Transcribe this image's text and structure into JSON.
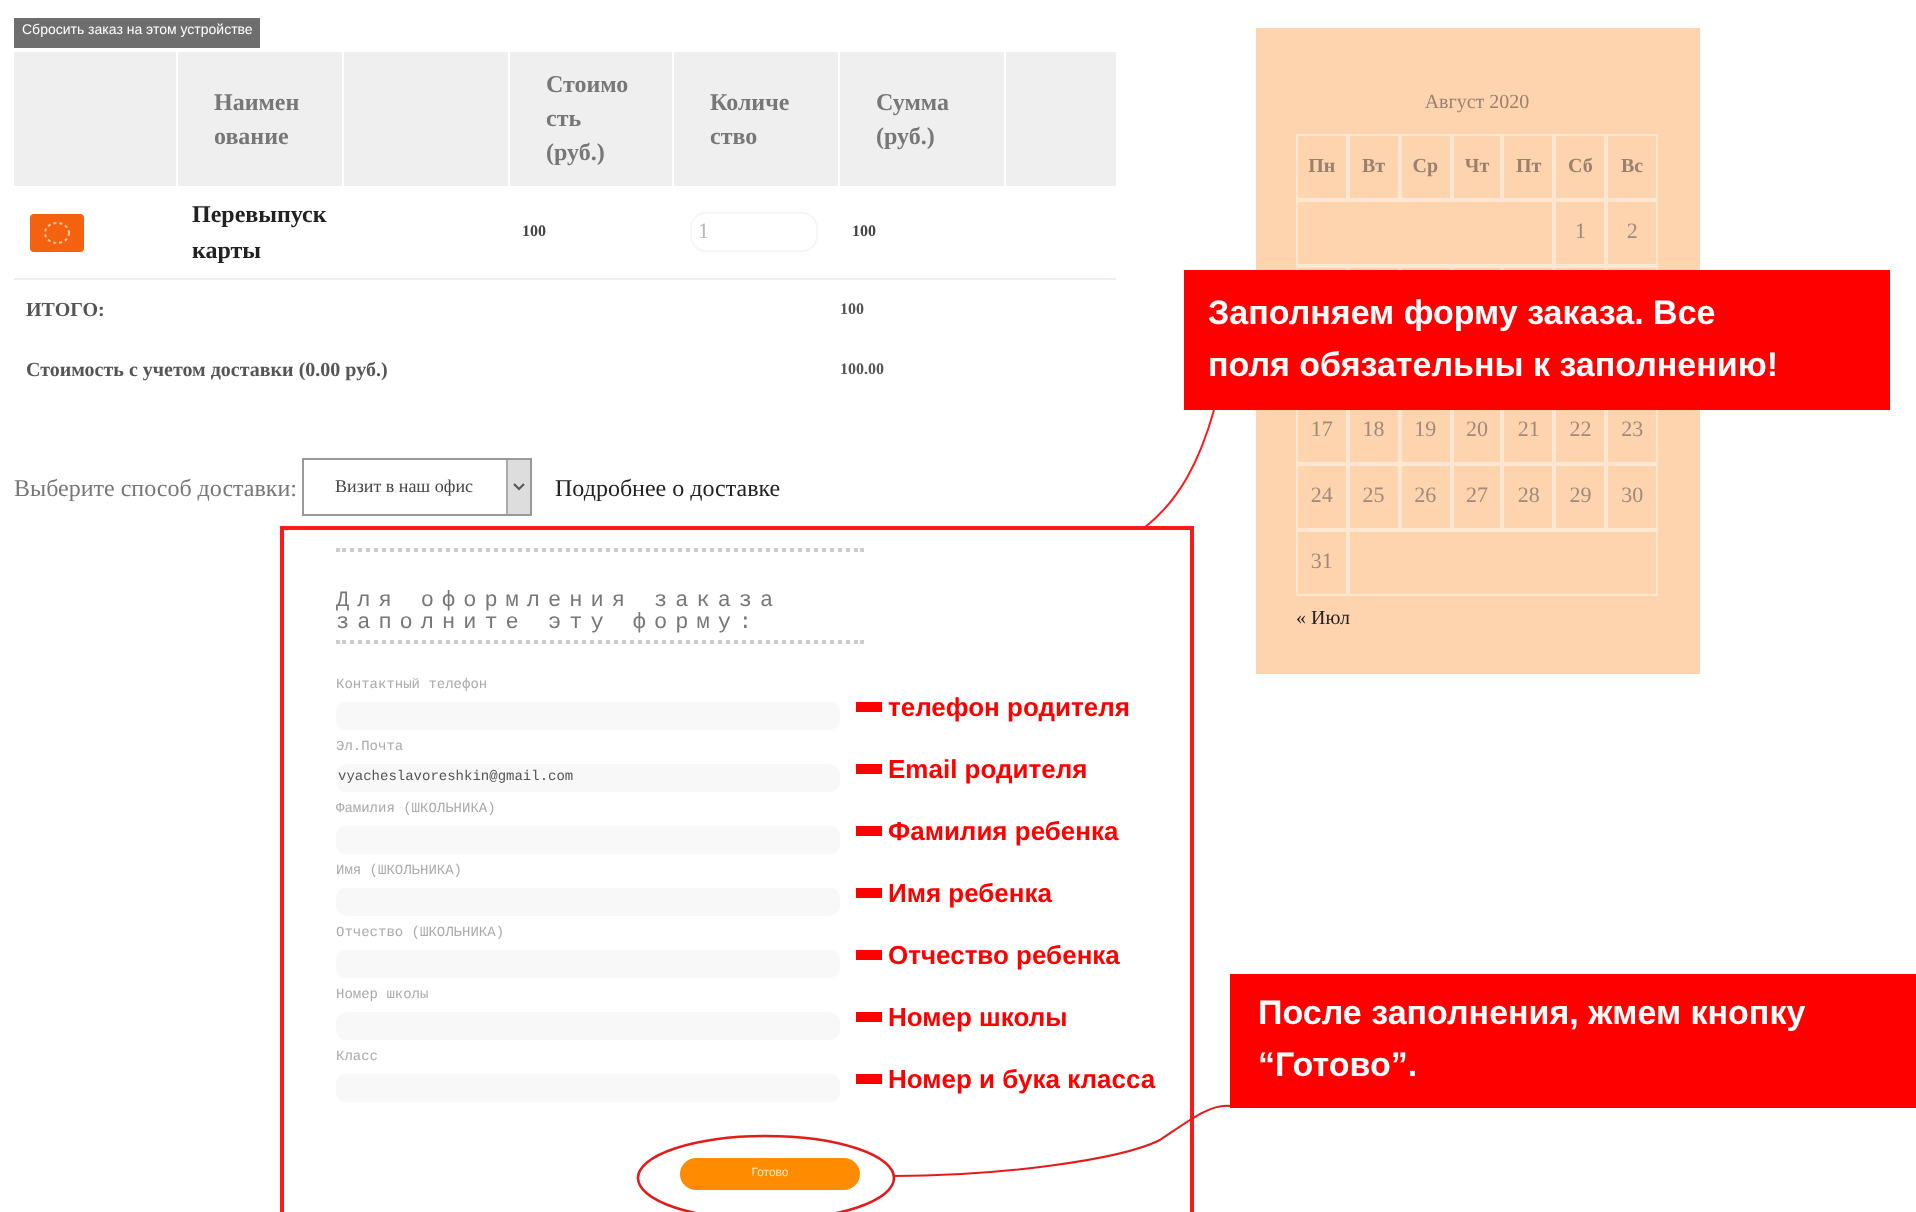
{
  "reset_button": "Сбросить заказ на этом устройстве",
  "cart_table": {
    "columns": [
      "Наимен\nование",
      "Стоимо\nсть\n(руб.)",
      "Количе\nство",
      "Сумма\n(руб.)"
    ],
    "rows": [
      {
        "kind": "item",
        "name": "Перевыпуск\nкарты",
        "price": "100",
        "quantity": "1",
        "sum": "100"
      }
    ],
    "totals": [
      {
        "label": "ИТОГО:",
        "value": "100"
      },
      {
        "label": "Стоимость с учетом доставки (0.00 руб.)",
        "value": "100.00"
      }
    ]
  },
  "delivery": {
    "label": "Выберите способ доставки:",
    "value": "Визит в наш офис",
    "link": "Подробнее о доставке"
  },
  "form": {
    "heading": "Для оформления заказа\nзаполните эту форму:",
    "fields": [
      {
        "label": "Контактный телефон",
        "annotation": "телефон родителя"
      },
      {
        "label": "Эл.Почта",
        "value": "vyacheslavoreshkin@gmail.com",
        "annotation": "Email родителя"
      },
      {
        "label": "Фамилия (ШКОЛЬНИКА)",
        "annotation": "Фамилия ребенка"
      },
      {
        "label": "Имя (ШКОЛЬНИКА)",
        "annotation": "Имя ребенка"
      },
      {
        "label": "Отчество (ШКОЛЬНИКА)",
        "annotation": "Отчество ребенка"
      },
      {
        "label": "Номер школы",
        "annotation": "Номер школы"
      },
      {
        "label": "Класс",
        "annotation": "Номер и бука класса"
      }
    ],
    "submit": "Готово"
  },
  "calendar": {
    "title": "Август 2020",
    "weekdays": [
      "Пн",
      "Вт",
      "Ср",
      "Чт",
      "Пт",
      "Сб",
      "Вс"
    ],
    "weeks_top": [
      {
        "kind": "start",
        "days": [
          "1",
          "2"
        ]
      }
    ],
    "weeks_bottom": [
      {
        "kind": "full",
        "days": [
          "17",
          "18",
          "19",
          "20",
          "21",
          "22",
          "23"
        ]
      },
      {
        "kind": "full",
        "days": [
          "24",
          "25",
          "26",
          "27",
          "28",
          "29",
          "30"
        ]
      },
      {
        "kind": "end",
        "days": [
          "31"
        ]
      }
    ],
    "prev_link": "« Июл"
  },
  "callouts": [
    {
      "text": "Заполняем форму заказа. Все\nполя обязательны к заполнению!"
    },
    {
      "text": "После заполнения, жмем кнопку\n“Готово”."
    }
  ]
}
